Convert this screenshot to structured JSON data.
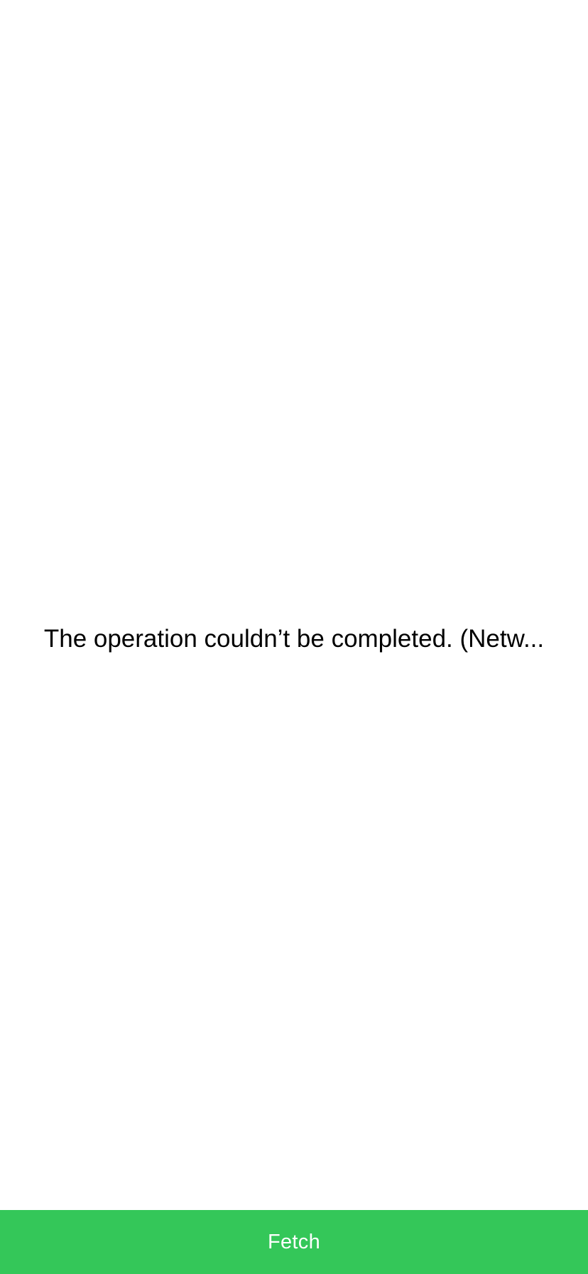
{
  "screen": {
    "status_message": "The operation couldn’t be completed. (Netw..."
  },
  "footer": {
    "fetch_label": "Fetch"
  },
  "colors": {
    "background": "#ffffff",
    "accent": "#34C759",
    "message_text": "#000000",
    "button_text": "#ffffff"
  }
}
